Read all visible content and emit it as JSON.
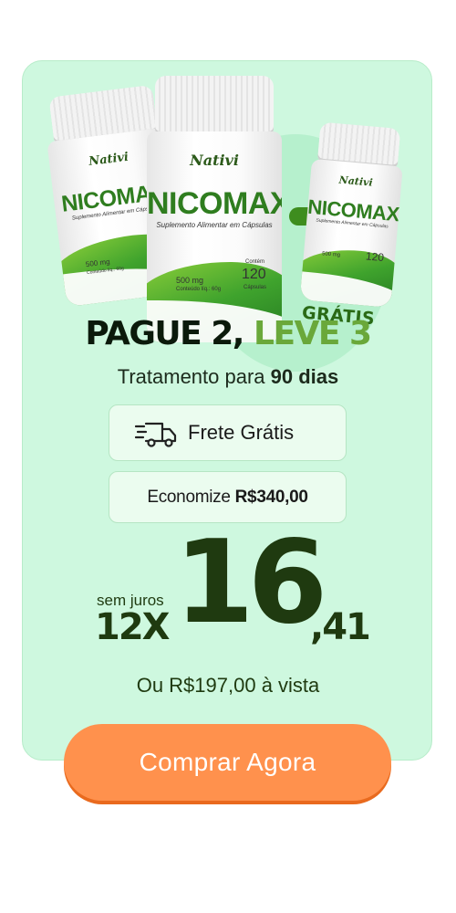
{
  "offer": {
    "bottle": {
      "brand": "Nativi",
      "product_name": "NICOMAX",
      "subtitle": "Suplemento Alimentar em Cápsulas",
      "dosage": "500 mg",
      "content": "Conteúdo líq.: 60g",
      "capsule_count": "120",
      "capsule_label": "Cápsulas",
      "contains_label": "Contém"
    },
    "free_label": "GRÁTIS",
    "headline_dark": "PAGUE 2,",
    "headline_green": "LEVE 3",
    "treatment_prefix": "Tratamento para ",
    "treatment_days": "90 dias",
    "shipping": "Frete Grátis",
    "savings_prefix": "Economize ",
    "savings_value": "R$340,00",
    "price": {
      "no_interest": "sem juros",
      "installments": "12X",
      "integer": "16",
      "decimal": ",41"
    },
    "cash_price": "Ou R$197,00 à vista",
    "buy_button": "Comprar Agora"
  },
  "colors": {
    "card_bg": "#cef8df",
    "brand_green": "#6aa83a",
    "dark_green": "#1f3a10",
    "button_orange": "#ff914d"
  },
  "icons": [
    "plus-icon",
    "truck-icon"
  ]
}
